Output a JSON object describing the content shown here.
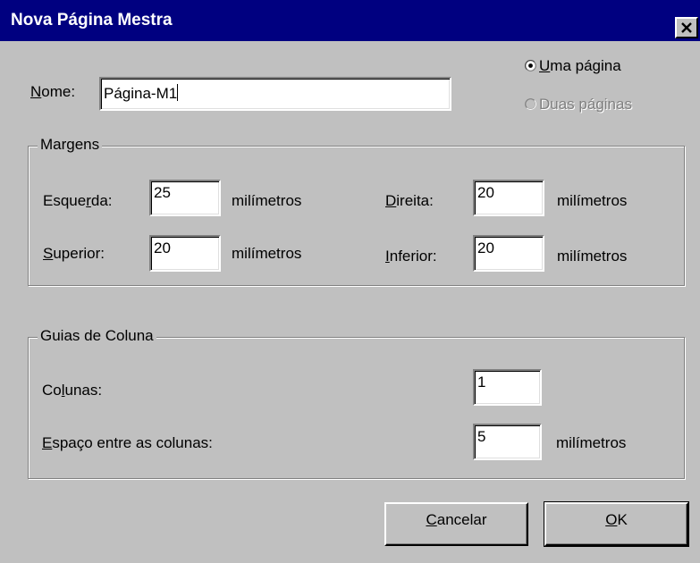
{
  "dialog": {
    "title": "Nova Página Mestra"
  },
  "name_field": {
    "label_mnemonic": "N",
    "label_rest": "ome:",
    "value": "Página-M1"
  },
  "page_options": {
    "single_mnemonic": "U",
    "single_rest": "ma página",
    "single_selected": true,
    "double_label": "Duas páginas",
    "double_enabled": false
  },
  "margins": {
    "group_title": "Margens",
    "left_pre": "Esque",
    "left_mnemonic": "r",
    "left_post": "da:",
    "left_value": "25",
    "top_mnemonic": "S",
    "top_rest": "uperior:",
    "top_value": "20",
    "right_mnemonic": "D",
    "right_rest": "ireita:",
    "right_value": "20",
    "bottom_mnemonic": "I",
    "bottom_rest": "nferior:",
    "bottom_value": "20",
    "unit": "milímetros"
  },
  "columns": {
    "group_title": "Guias de Coluna",
    "count_pre": "Co",
    "count_mnemonic": "l",
    "count_post": "unas:",
    "count_value": "1",
    "gutter_mnemonic": "E",
    "gutter_rest": "spaço entre as colunas:",
    "gutter_value": "5",
    "unit": "milímetros"
  },
  "buttons": {
    "cancel_mnemonic": "C",
    "cancel_rest": "ancelar",
    "ok_mnemonic": "O",
    "ok_rest": "K"
  }
}
